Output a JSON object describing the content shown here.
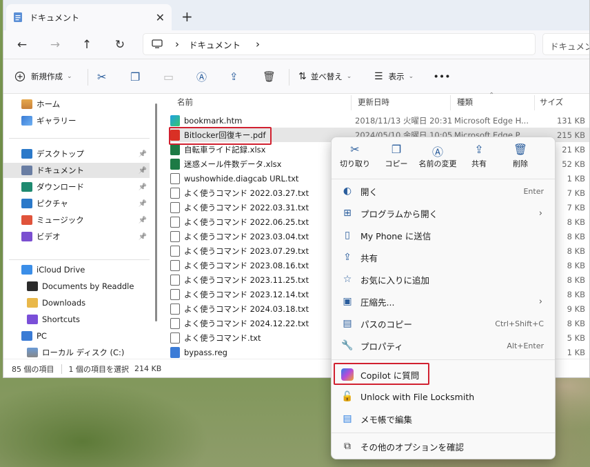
{
  "tab": {
    "title": "ドキュメント",
    "close": "✕",
    "new": "+"
  },
  "nav": {
    "back": "←",
    "forward": "→",
    "up": "↑",
    "refresh": "↻",
    "chevron": "›",
    "crumb": "ドキュメント",
    "chevron2": "›",
    "search_placeholder": "ドキュメント"
  },
  "toolbar": {
    "new_label": "新規作成",
    "sort_label": "並べ替え",
    "view_label": "表示",
    "more": "•••"
  },
  "sidebar": {
    "home": "ホーム",
    "gallery": "ギャラリー",
    "pinned": [
      {
        "label": "デスクトップ"
      },
      {
        "label": "ドキュメント"
      },
      {
        "label": "ダウンロード"
      },
      {
        "label": "ピクチャ"
      },
      {
        "label": "ミュージック"
      },
      {
        "label": "ビデオ"
      }
    ],
    "cloud": [
      {
        "label": "iCloud Drive"
      },
      {
        "label": "Documents by Readdle"
      },
      {
        "label": "Downloads"
      },
      {
        "label": "Shortcuts"
      }
    ],
    "pc": "PC",
    "disk": "ローカル ディスク (C:)"
  },
  "columns": {
    "name": "名前",
    "date": "更新日時",
    "type": "種類",
    "size": "サイズ"
  },
  "files": [
    {
      "name": "bookmark.htm",
      "date": "2018/11/13 火曜日 20:31",
      "type": "Microsoft Edge H...",
      "size": "131 KB",
      "kind": "edge"
    },
    {
      "name": "Bitlocker回復キー.pdf",
      "date": "2024/05/10 金曜日 10:05",
      "type": "Microsoft Edge P...",
      "size": "215 KB",
      "kind": "pdf"
    },
    {
      "name": "自転車ライド記録.xlsx",
      "date": "",
      "type": "",
      "size": "21 KB",
      "kind": "xlsx"
    },
    {
      "name": "迷惑メール件数データ.xlsx",
      "date": "",
      "type": "",
      "size": "52 KB",
      "kind": "xlsx"
    },
    {
      "name": "wushowhide.diagcab URL.txt",
      "date": "",
      "type": "",
      "size": "1 KB",
      "kind": "txt"
    },
    {
      "name": "よく使うコマンド 2022.03.27.txt",
      "date": "",
      "type": "",
      "size": "7 KB",
      "kind": "txt"
    },
    {
      "name": "よく使うコマンド 2022.03.31.txt",
      "date": "",
      "type": "",
      "size": "7 KB",
      "kind": "txt"
    },
    {
      "name": "よく使うコマンド 2022.06.25.txt",
      "date": "",
      "type": "",
      "size": "8 KB",
      "kind": "txt"
    },
    {
      "name": "よく使うコマンド 2023.03.04.txt",
      "date": "",
      "type": "",
      "size": "8 KB",
      "kind": "txt"
    },
    {
      "name": "よく使うコマンド 2023.07.29.txt",
      "date": "",
      "type": "",
      "size": "8 KB",
      "kind": "txt"
    },
    {
      "name": "よく使うコマンド 2023.08.16.txt",
      "date": "",
      "type": "",
      "size": "8 KB",
      "kind": "txt"
    },
    {
      "name": "よく使うコマンド 2023.11.25.txt",
      "date": "",
      "type": "",
      "size": "8 KB",
      "kind": "txt"
    },
    {
      "name": "よく使うコマンド 2023.12.14.txt",
      "date": "",
      "type": "",
      "size": "8 KB",
      "kind": "txt"
    },
    {
      "name": "よく使うコマンド 2024.03.18.txt",
      "date": "",
      "type": "",
      "size": "9 KB",
      "kind": "txt"
    },
    {
      "name": "よく使うコマンド 2024.12.22.txt",
      "date": "",
      "type": "",
      "size": "8 KB",
      "kind": "txt"
    },
    {
      "name": "よく使うコマンド.txt",
      "date": "",
      "type": "",
      "size": "5 KB",
      "kind": "txt"
    },
    {
      "name": "bypass.reg",
      "date": "",
      "type": "",
      "size": "1 KB",
      "kind": "reg"
    }
  ],
  "status": {
    "count": "85 個の項目",
    "selected": "1 個の項目を選択",
    "size": "214 KB"
  },
  "menu": {
    "quick": [
      {
        "label": "切り取り",
        "icon": "cut-icon",
        "glyph": "✂"
      },
      {
        "label": "コピー",
        "icon": "copy-icon",
        "glyph": "❐"
      },
      {
        "label": "名前の変更",
        "icon": "rename-icon",
        "glyph": "Ⓐ"
      },
      {
        "label": "共有",
        "icon": "share-icon",
        "glyph": "⇪"
      },
      {
        "label": "削除",
        "icon": "delete-icon",
        "glyph": "🗑"
      }
    ],
    "items": [
      {
        "label": "開く",
        "key": "Enter",
        "icon": "edge-icon",
        "glyph": "◐"
      },
      {
        "label": "プログラムから開く",
        "key": "",
        "icon": "open-with-icon",
        "glyph": "⊞",
        "sub": true
      },
      {
        "label": "My Phone に送信",
        "key": "",
        "icon": "phone-icon",
        "glyph": "▯"
      },
      {
        "label": "共有",
        "key": "",
        "icon": "share-icon",
        "glyph": "⇪"
      },
      {
        "label": "お気に入りに追加",
        "key": "",
        "icon": "star-icon",
        "glyph": "☆"
      },
      {
        "label": "圧縮先...",
        "key": "",
        "icon": "zip-icon",
        "glyph": "▣",
        "sub": true
      },
      {
        "label": "パスのコピー",
        "key": "Ctrl+Shift+C",
        "icon": "path-icon",
        "glyph": "▤"
      },
      {
        "label": "プロパティ",
        "key": "Alt+Enter",
        "icon": "wrench-icon",
        "glyph": "🔧"
      }
    ],
    "copilot": "Copilot に質問",
    "unlock": "Unlock with File Locksmith",
    "notepad": "メモ帳で編集",
    "more": "その他のオプションを確認",
    "submenu_arrow": "›"
  }
}
